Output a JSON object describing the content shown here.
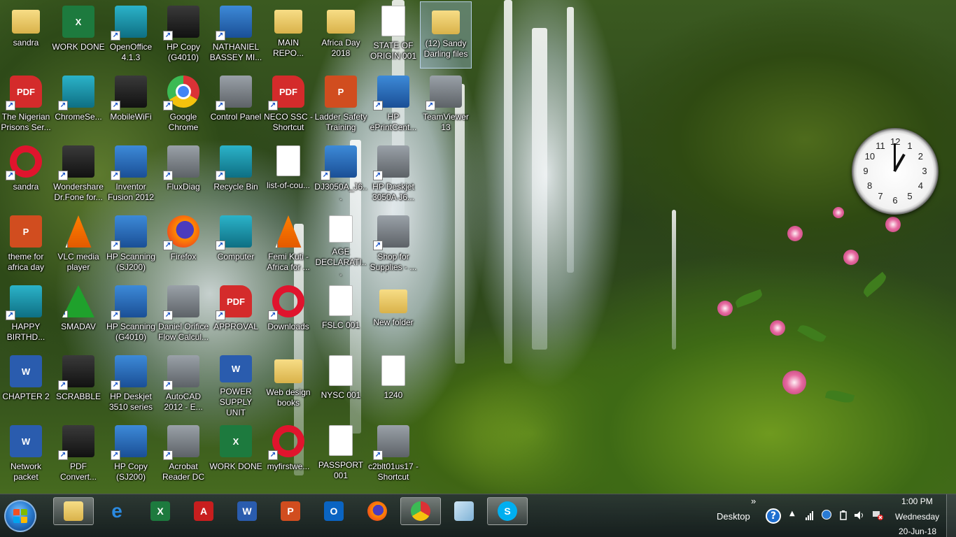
{
  "desktop": {
    "icons": [
      {
        "id": "sandra-folder",
        "label": "sandra",
        "type": "folder"
      },
      {
        "id": "work-done-1",
        "label": "WORK DONE",
        "type": "excel"
      },
      {
        "id": "openoffice",
        "label": "OpenOffice 4.1.3",
        "type": "app"
      },
      {
        "id": "hp-copy-g4010",
        "label": "HP Copy (G4010)",
        "type": "app"
      },
      {
        "id": "nathaniel",
        "label": "NATHANIEL BASSEY MI...",
        "type": "app"
      },
      {
        "id": "main-repo",
        "label": "MAIN REPO...",
        "type": "folder"
      },
      {
        "id": "africa-day",
        "label": "Africa Day 2018",
        "type": "folder"
      },
      {
        "id": "state-of-origin",
        "label": "STATE OF ORIGIN 001",
        "type": "doc"
      },
      {
        "id": "sandy-darling",
        "label": "(12) Sandy Darling files",
        "type": "folder"
      },
      {
        "id": "nigerian-prisons",
        "label": "The Nigerian Prisons Ser...",
        "type": "pdf"
      },
      {
        "id": "chromese",
        "label": "ChromeSe...",
        "type": "app"
      },
      {
        "id": "mobilewifi",
        "label": "MobileWiFi",
        "type": "app"
      },
      {
        "id": "google-chrome",
        "label": "Google Chrome",
        "type": "chrome"
      },
      {
        "id": "control-panel",
        "label": "Control Panel",
        "type": "app"
      },
      {
        "id": "neco-ssc",
        "label": "NECO SSC - Shortcut",
        "type": "pdf"
      },
      {
        "id": "ladder-safety",
        "label": "Ladder Safety Training",
        "type": "ppt"
      },
      {
        "id": "hp-eprint",
        "label": "HP ePrintCent...",
        "type": "app"
      },
      {
        "id": "teamviewer",
        "label": "TeamViewer 13",
        "type": "app"
      },
      {
        "id": "sandra-opera",
        "label": "sandra",
        "type": "opera"
      },
      {
        "id": "wondershare",
        "label": "Wondershare Dr.Fone for...",
        "type": "app"
      },
      {
        "id": "inventor-fusion",
        "label": "Inventor Fusion 2012",
        "type": "app"
      },
      {
        "id": "fluxdiag",
        "label": "FluxDiag",
        "type": "app"
      },
      {
        "id": "recycle-bin",
        "label": "Recycle Bin",
        "type": "app"
      },
      {
        "id": "list-of-cou",
        "label": "list-of-cou...",
        "type": "doc"
      },
      {
        "id": "dj3050a",
        "label": "DJ3050A_J6...",
        "type": "app"
      },
      {
        "id": "hp-deskjet-3050a",
        "label": "HP Deskjet 3050A J6...",
        "type": "app"
      },
      {
        "id": "theme-africa-day",
        "label": "theme for africa day",
        "type": "ppt"
      },
      {
        "id": "vlc",
        "label": "VLC media player",
        "type": "vlc"
      },
      {
        "id": "hp-scanning-sj200",
        "label": "HP Scanning (SJ200)",
        "type": "app"
      },
      {
        "id": "firefox",
        "label": "Firefox",
        "type": "firefox"
      },
      {
        "id": "computer",
        "label": "Computer",
        "type": "app"
      },
      {
        "id": "femi-kuti",
        "label": "Femi Kuti - Africa for ...",
        "type": "vlc"
      },
      {
        "id": "age-declaration",
        "label": "AGE DECLARATI...",
        "type": "doc"
      },
      {
        "id": "shop-supplies",
        "label": "Shop for Supplies - ...",
        "type": "app"
      },
      {
        "id": "happy-birthday",
        "label": "HAPPY BIRTHD...",
        "type": "app"
      },
      {
        "id": "smadav",
        "label": "SMADAV",
        "type": "smadav"
      },
      {
        "id": "hp-scanning-g4010",
        "label": "HP Scanning (G4010)",
        "type": "app"
      },
      {
        "id": "daniel-orifice",
        "label": "Daniel Orifice Flow Calcul...",
        "type": "app"
      },
      {
        "id": "approval",
        "label": "APPROVAL",
        "type": "pdf"
      },
      {
        "id": "downloads",
        "label": "Downloads",
        "type": "opera"
      },
      {
        "id": "fslc-001",
        "label": "FSLC 001",
        "type": "doc"
      },
      {
        "id": "new-folder",
        "label": "New folder",
        "type": "folder"
      },
      {
        "id": "chapter-2",
        "label": "CHAPTER 2",
        "type": "word"
      },
      {
        "id": "scrabble",
        "label": "SCRABBLE",
        "type": "app"
      },
      {
        "id": "hp-deskjet-3510",
        "label": "HP Deskjet 3510 series",
        "type": "app"
      },
      {
        "id": "autocad",
        "label": "AutoCAD 2012 - E...",
        "type": "app"
      },
      {
        "id": "power-supply",
        "label": "POWER SUPPLY UNIT",
        "type": "word"
      },
      {
        "id": "web-design-books",
        "label": "Web design books",
        "type": "folder"
      },
      {
        "id": "nysc-001",
        "label": "NYSC 001",
        "type": "doc"
      },
      {
        "id": "doc-1240",
        "label": "1240",
        "type": "doc"
      },
      {
        "id": "network-packet",
        "label": "Network packet",
        "type": "word"
      },
      {
        "id": "pdf-convert",
        "label": "PDF Convert...",
        "type": "app"
      },
      {
        "id": "hp-copy-sj200",
        "label": "HP Copy (SJ200)",
        "type": "app"
      },
      {
        "id": "acrobat-reader",
        "label": "Acrobat Reader DC",
        "type": "app"
      },
      {
        "id": "work-done-2",
        "label": "WORK DONE",
        "type": "excel"
      },
      {
        "id": "myfirstwe",
        "label": "myfirstwe...",
        "type": "opera"
      },
      {
        "id": "passport",
        "label": "PASSPORT 001",
        "type": "doc"
      },
      {
        "id": "c2blt01us17",
        "label": "c2blt01us17 - Shortcut",
        "type": "app"
      }
    ]
  },
  "clock_gadget": {
    "numbers": [
      "12",
      "1",
      "2",
      "3",
      "4",
      "5",
      "6",
      "7",
      "8",
      "9",
      "10",
      "11"
    ],
    "hour": 1,
    "minute": 0
  },
  "taskbar": {
    "pinned": [
      {
        "id": "explorer",
        "icon": "folder-icon",
        "active": true
      },
      {
        "id": "internet-explorer",
        "icon": "internet-explorer-icon",
        "active": false
      },
      {
        "id": "excel",
        "icon": "excel-icon",
        "active": false
      },
      {
        "id": "acrobat",
        "icon": "acrobat-icon",
        "active": false
      },
      {
        "id": "word",
        "icon": "word-icon",
        "active": false
      },
      {
        "id": "powerpoint",
        "icon": "powerpoint-icon",
        "active": false
      },
      {
        "id": "outlook",
        "icon": "outlook-icon",
        "active": false
      },
      {
        "id": "firefox",
        "icon": "firefox-icon",
        "active": false
      },
      {
        "id": "chrome",
        "icon": "chrome-icon",
        "active": true
      },
      {
        "id": "unknown",
        "icon": "glass-icon",
        "active": false
      },
      {
        "id": "skype",
        "icon": "skype-icon",
        "active": true
      }
    ],
    "toolbar_label": "Desktop",
    "toolbar_chevron": "»",
    "time": "1:00 PM",
    "day": "Wednesday",
    "date": "20-Jun-18"
  }
}
